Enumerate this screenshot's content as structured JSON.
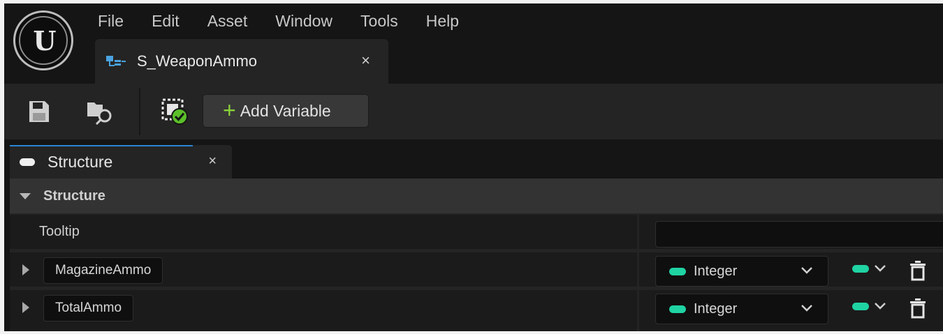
{
  "menu": {
    "items": [
      "File",
      "Edit",
      "Asset",
      "Window",
      "Tools",
      "Help"
    ]
  },
  "document_tab": {
    "title": "S_WeaponAmmo",
    "close": "×",
    "icon": "struct-asset-icon"
  },
  "toolbar": {
    "save_icon": "save-icon",
    "browse_icon": "browse-content-icon",
    "validate_icon": "struct-validate-icon",
    "add_variable_plus": "+",
    "add_variable_label": "Add Variable"
  },
  "panel_tab": {
    "title": "Structure",
    "close": "×"
  },
  "details": {
    "category": "Structure",
    "tooltip_label": "Tooltip",
    "tooltip_value": "",
    "variables": [
      {
        "name": "MagazineAmmo",
        "type": "Integer",
        "type_color": "#1fd3a3"
      },
      {
        "name": "TotalAmmo",
        "type": "Integer",
        "type_color": "#1fd3a3"
      }
    ]
  },
  "colors": {
    "accent_blue": "#2a86d6",
    "add_green": "#8ad33a",
    "integer_pin": "#1fd3a3"
  }
}
